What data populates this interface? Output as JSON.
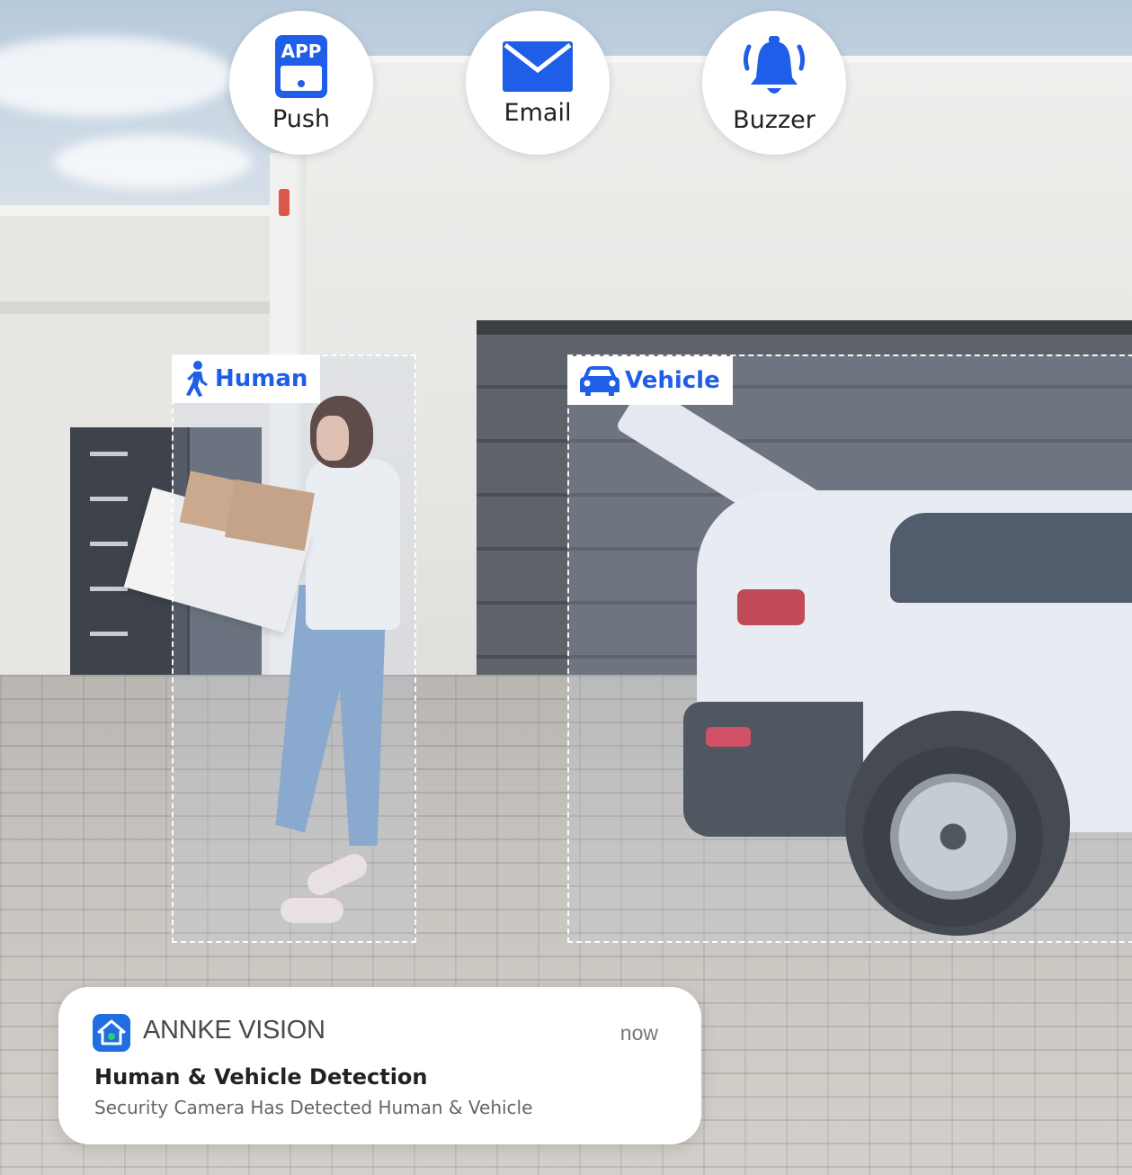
{
  "alerts": [
    {
      "label": "Push",
      "icon": "app-phone-icon",
      "icon_text": "APP"
    },
    {
      "label": "Email",
      "icon": "envelope-icon"
    },
    {
      "label": "Buzzer",
      "icon": "bell-icon"
    }
  ],
  "detections": {
    "human": {
      "label": "Human",
      "icon": "person-walking-icon"
    },
    "vehicle": {
      "label": "Vehicle",
      "icon": "car-icon"
    }
  },
  "notification": {
    "app_name": "ANNKE VISION",
    "time": "now",
    "title": "Human & Vehicle Detection",
    "body": "Security Camera Has Detected Human & Vehicle",
    "icon": "annke-home-icon"
  },
  "colors": {
    "accent_blue": "#1f5ee8",
    "card_white": "#ffffff"
  }
}
